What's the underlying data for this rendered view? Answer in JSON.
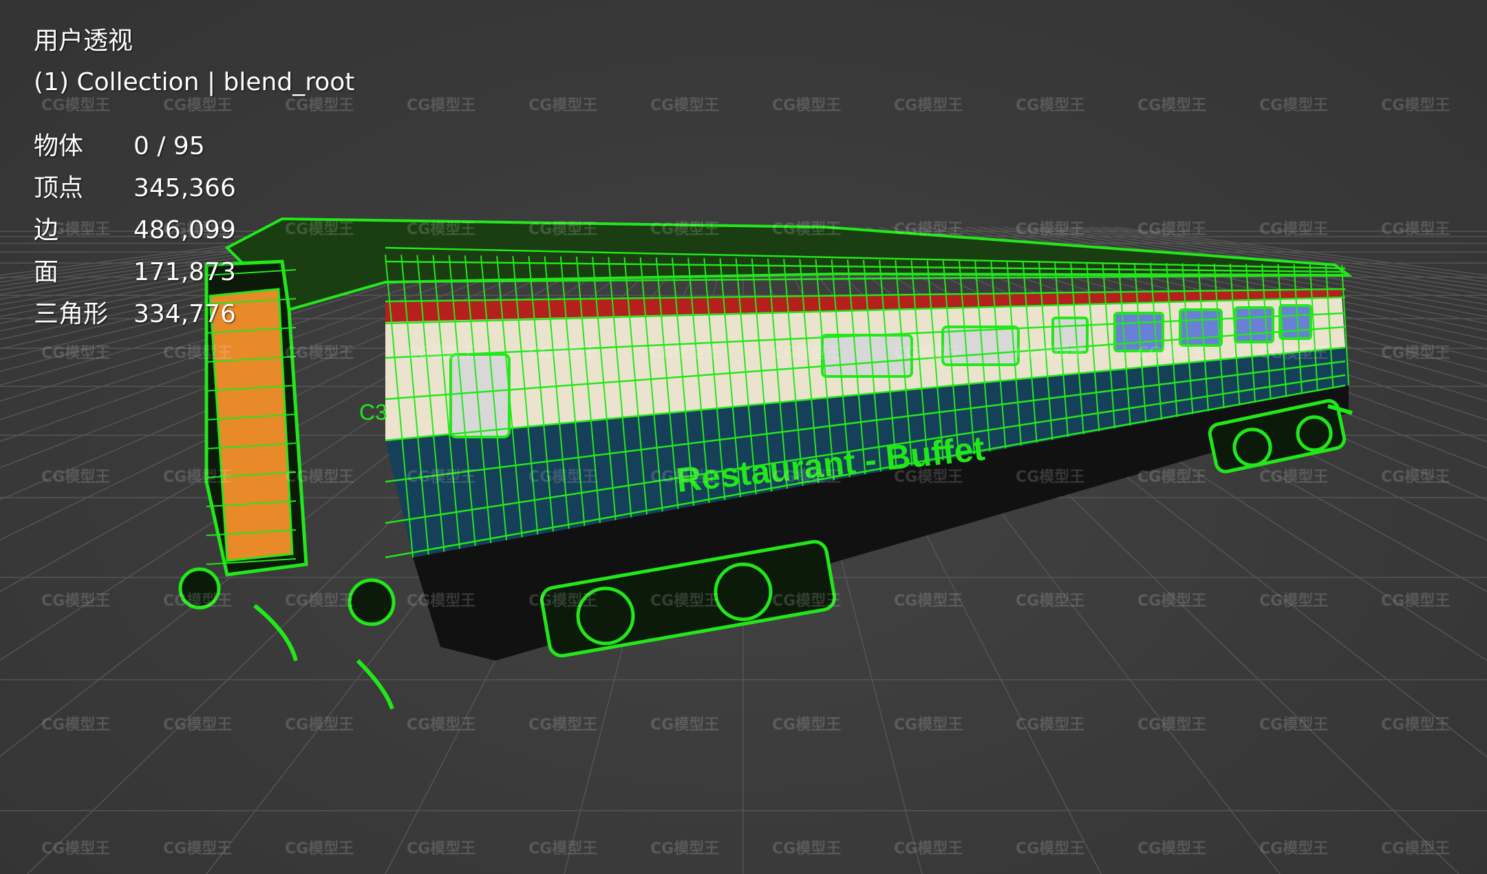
{
  "viewport": {
    "view_name": "用户透视",
    "collection": "(1) Collection | blend_root",
    "stats": [
      {
        "label": "物体",
        "value": "0 / 95"
      },
      {
        "label": "顶点",
        "value": "345,366"
      },
      {
        "label": "边",
        "value": "486,099"
      },
      {
        "label": "面",
        "value": "171,873"
      },
      {
        "label": "三角形",
        "value": "334,776"
      }
    ]
  },
  "model": {
    "livery_text": "Restaurant - Buffet",
    "coach_code": "C3",
    "wire_color": "#22e81a"
  },
  "watermark": {
    "text": "CG模型王"
  },
  "colors": {
    "background": "#3b3b3b",
    "grid": "#555555",
    "stripe_red": "#b5201c",
    "body_cream": "#ece3cf",
    "body_blue": "#163f5a",
    "end_orange": "#e88a2a",
    "underframe": "#111111"
  }
}
